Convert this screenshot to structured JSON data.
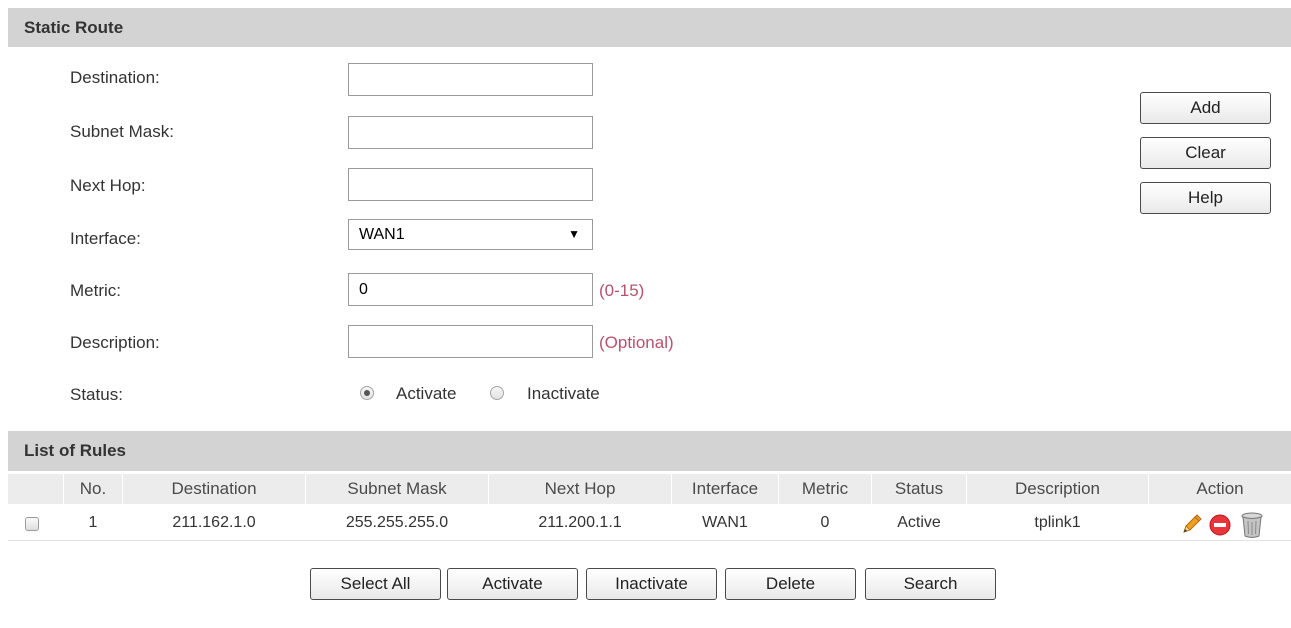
{
  "static_route": {
    "title": "Static Route",
    "destination_label": "Destination:",
    "destination_value": "",
    "subnet_mask_label": "Subnet Mask:",
    "subnet_mask_value": "",
    "next_hop_label": "Next Hop:",
    "next_hop_value": "",
    "interface_label": "Interface:",
    "interface_value": "WAN1",
    "metric_label": "Metric:",
    "metric_value": "0",
    "metric_hint": "(0-15)",
    "description_label": "Description:",
    "description_value": "",
    "description_hint": "(Optional)",
    "status_label": "Status:",
    "status_options": [
      "Activate",
      "Inactivate"
    ],
    "status_selected": "Activate",
    "buttons": {
      "add": "Add",
      "clear": "Clear",
      "help": "Help"
    }
  },
  "rules": {
    "title": "List of Rules",
    "columns": [
      "No.",
      "Destination",
      "Subnet Mask",
      "Next Hop",
      "Interface",
      "Metric",
      "Status",
      "Description",
      "Action"
    ],
    "rows": [
      {
        "no": "1",
        "destination": "211.162.1.0",
        "subnet_mask": "255.255.255.0",
        "next_hop": "211.200.1.1",
        "interface": "WAN1",
        "metric": "0",
        "status": "Active",
        "description": "tplink1",
        "actions": [
          "edit-pencil-icon",
          "disable-icon",
          "delete-trash-icon"
        ]
      }
    ],
    "buttons": {
      "select_all": "Select All",
      "activate": "Activate",
      "inactivate": "Inactivate",
      "delete": "Delete",
      "search": "Search"
    }
  },
  "colors": {
    "header_bg": "#d3d3d3",
    "table_header_bg": "#ececec",
    "hint": "#b5536f",
    "disable_red": "#e8343a",
    "pencil": "#f0a020"
  }
}
